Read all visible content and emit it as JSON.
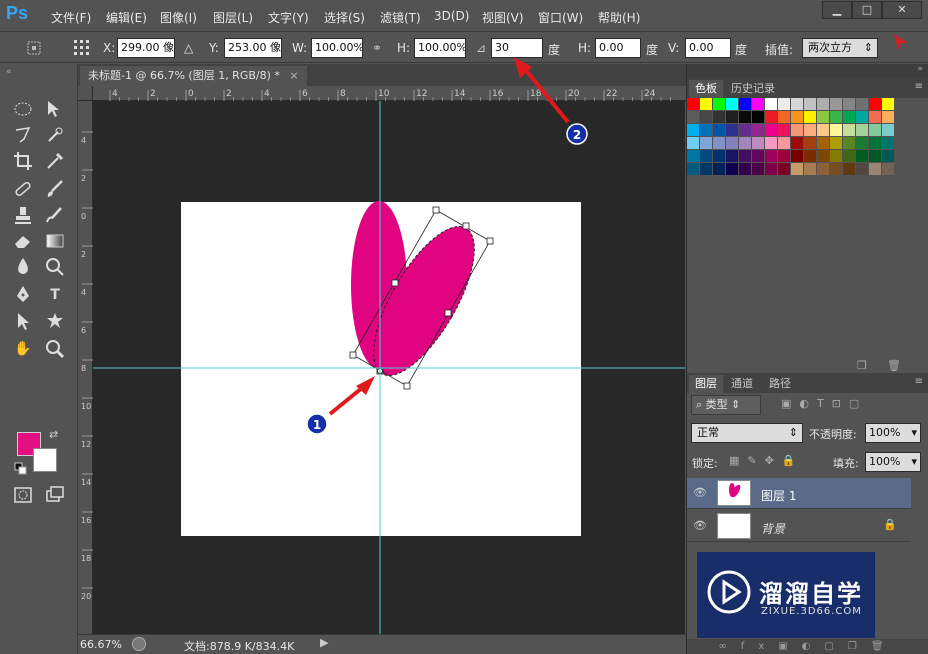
{
  "app": {
    "logo": "Ps"
  },
  "menu": [
    "文件(F)",
    "编辑(E)",
    "图像(I)",
    "图层(L)",
    "文字(Y)",
    "选择(S)",
    "滤镜(T)",
    "3D(D)",
    "视图(V)",
    "窗口(W)",
    "帮助(H)"
  ],
  "window_controls": {
    "minimize": "▁",
    "maximize": "□",
    "close": "✕"
  },
  "options": {
    "x_label": "X:",
    "x_value": "299.00 像",
    "y_label": "Y:",
    "y_value": "253.00 像",
    "w_label": "W:",
    "w_value": "100.00%",
    "h_label": "H:",
    "h_value": "100.00%",
    "angle_value": "30",
    "angle_unit": "度",
    "hskew_label": "H:",
    "hskew_value": "0.00",
    "hskew_unit": "度",
    "vskew_label": "V:",
    "vskew_value": "0.00",
    "vskew_unit": "度",
    "interp_label": "插值:",
    "interp_value": "两次立方"
  },
  "document": {
    "tab_title": "未标题-1 @ 66.7% (图层 1, RGB/8) *",
    "tab_close": "×"
  },
  "rulers": {
    "top_ticks": [
      "4",
      "2",
      "0",
      "2",
      "4",
      "6",
      "8",
      "10",
      "12",
      "14",
      "16",
      "18",
      "20",
      "22",
      "24"
    ],
    "left_ticks": [
      "4",
      "2",
      "0",
      "2",
      "4",
      "6",
      "8",
      "10",
      "12",
      "14",
      "16",
      "18",
      "20"
    ]
  },
  "status": {
    "zoom": "66.67%",
    "doc_info": "文档:878.9 K/834.4K"
  },
  "annotations": {
    "marker_1": "1",
    "marker_2": "2"
  },
  "colors": {
    "foreground": "#e40f80",
    "background": "#ffffff",
    "shape": "#e00480",
    "guide": "#4fd0d8",
    "arrow": "#e01a1a"
  },
  "panels": {
    "swatch_tabs": [
      "色板",
      "历史记录"
    ],
    "layer_tabs": [
      "图层",
      "通道",
      "路径"
    ],
    "filter_kind": "类型",
    "blend_mode": "正常",
    "opacity_label": "不透明度:",
    "opacity_value": "100%",
    "lock_label": "锁定:",
    "fill_label": "填充:",
    "fill_value": "100%",
    "layers": [
      {
        "name": "图层 1",
        "selected": true
      },
      {
        "name": "背景",
        "selected": false
      }
    ]
  },
  "watermark": {
    "brand": "溜溜自学",
    "url": "ZIXUE.3D66.COM"
  }
}
